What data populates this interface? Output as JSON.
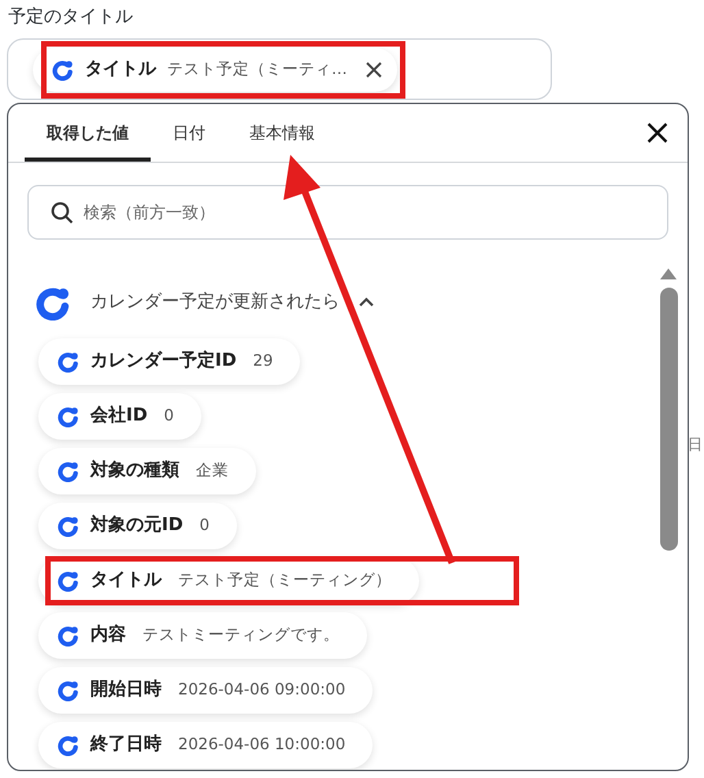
{
  "field": {
    "label": "予定のタイトル",
    "chip": {
      "name": "タイトル",
      "value": "テスト予定（ミーティ…",
      "removable": true,
      "highlighted": true
    }
  },
  "popup": {
    "tabs": [
      {
        "label": "取得した値",
        "selected": true
      },
      {
        "label": "日付",
        "selected": false
      },
      {
        "label": "基本情報",
        "selected": false
      }
    ],
    "search": {
      "placeholder": "検索（前方一致）"
    },
    "section": {
      "title": "カレンダー予定が更新されたら",
      "expanded": true,
      "items": [
        {
          "name": "カレンダー予定ID",
          "value": "29",
          "highlighted": false
        },
        {
          "name": "会社ID",
          "value": "0",
          "highlighted": false
        },
        {
          "name": "対象の種類",
          "value": "企業",
          "highlighted": false
        },
        {
          "name": "対象の元ID",
          "value": "0",
          "highlighted": false
        },
        {
          "name": "タイトル",
          "value": "テスト予定（ミーティング）",
          "highlighted": true
        },
        {
          "name": "内容",
          "value": "テストミーティングです。",
          "highlighted": false
        },
        {
          "name": "開始日時",
          "value": "2026-04-06 09:00:00",
          "highlighted": false
        },
        {
          "name": "終了日時",
          "value": "2026-04-06 10:00:00",
          "highlighted": false
        }
      ]
    }
  },
  "background_text": "日"
}
